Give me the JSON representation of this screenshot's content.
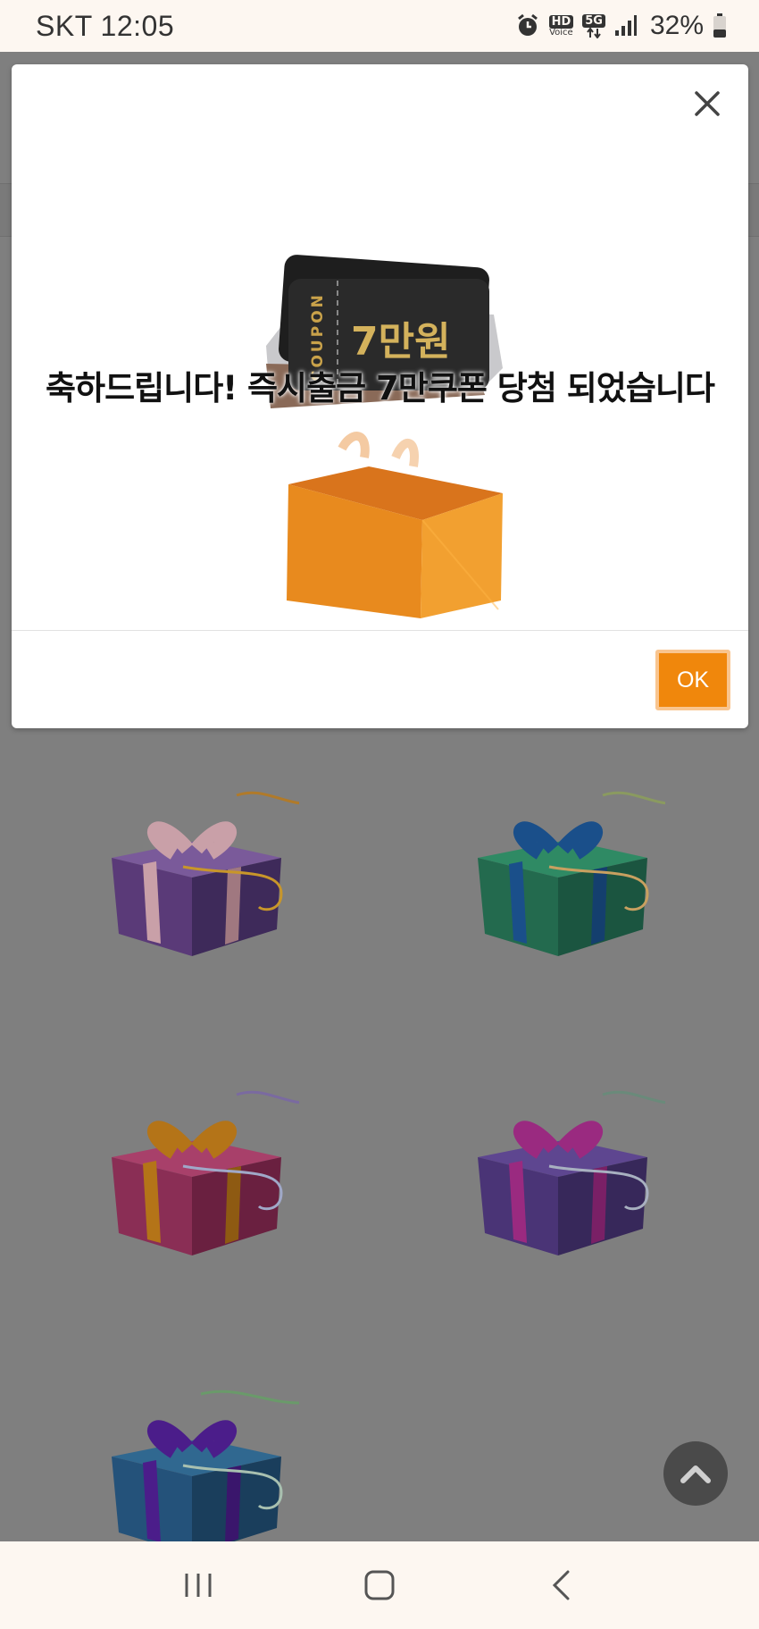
{
  "status_bar": {
    "carrier_time": "SKT 12:05",
    "hd_label": "HD",
    "hd_sub": "Voice",
    "network": "5G",
    "battery": "32%"
  },
  "modal": {
    "title": "축하드립니다! 즉시출금 7만쿠폰 당첨 되었습니다",
    "coupon_label": "COUPON",
    "coupon_amount": "7만원",
    "ok_label": "OK",
    "close_icon": "close-icon"
  },
  "colors": {
    "accent": "#f0870c",
    "overlay": "#7f7f7f",
    "system_bar": "#fdf7f1"
  },
  "gifts": [
    {
      "box": "#5a3a78",
      "ribbon": "#c9a0a8"
    },
    {
      "box": "#236a4e",
      "ribbon": "#1a4f8a"
    },
    {
      "box": "#8a2e55",
      "ribbon": "#b47418"
    },
    {
      "box": "#4a3476",
      "ribbon": "#9a2a80"
    },
    {
      "box": "#24527a",
      "ribbon": "#4b1d8a"
    }
  ],
  "nav": {
    "recents": "recents-icon",
    "home": "home-icon",
    "back": "back-icon"
  }
}
